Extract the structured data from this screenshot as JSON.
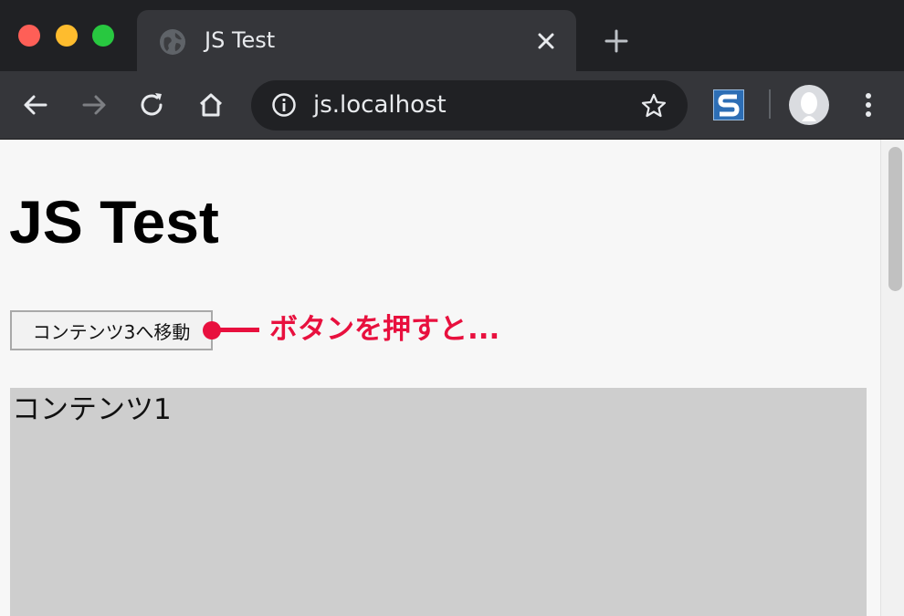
{
  "window": {
    "traffic_colors": {
      "close": "#fe5f57",
      "minimize": "#febc2e",
      "maximize": "#28c840"
    }
  },
  "tab": {
    "title": "JS Test",
    "favicon": "globe-icon"
  },
  "toolbar": {
    "url": "js.localhost",
    "icons": [
      "back-arrow-icon",
      "forward-arrow-icon",
      "reload-icon",
      "home-icon",
      "info-icon",
      "star-icon",
      "extension-s-icon",
      "profile-avatar",
      "more-vert-icon"
    ]
  },
  "page": {
    "title": "JS Test",
    "button_label": "コンテンツ3へ移動",
    "annotation": "ボタンを押すと...",
    "annotation_color": "#e8103e",
    "content_label": "コンテンツ1",
    "content_bg": "#cecece"
  }
}
